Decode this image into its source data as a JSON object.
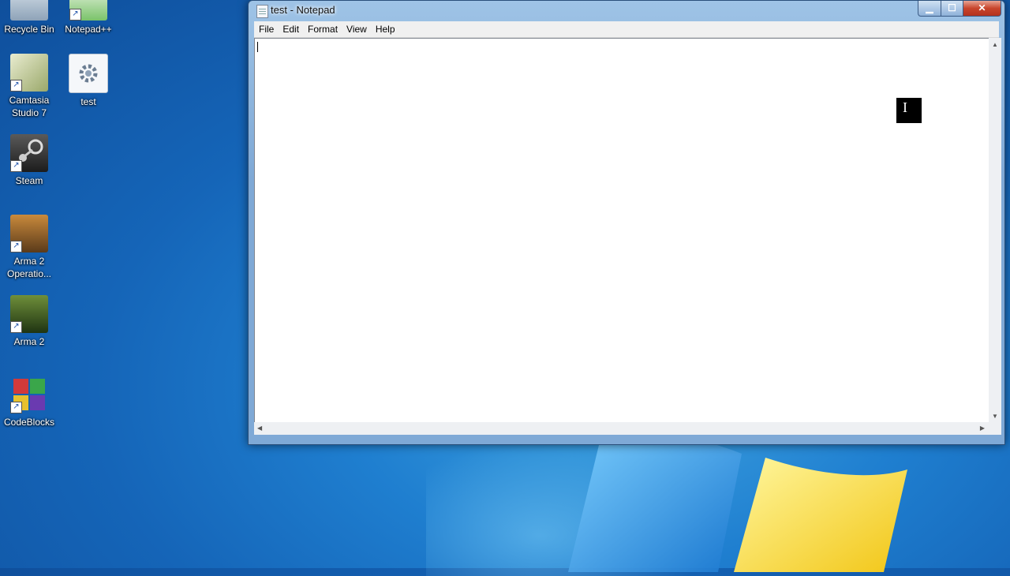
{
  "desktop": {
    "icons": [
      {
        "label": "Recycle Bin",
        "icon": "recycle-bin-icon",
        "color": "#9fb3c8"
      },
      {
        "label": "Notepad++",
        "icon": "notepad-plus-plus-icon",
        "color": "#5cb85c"
      },
      {
        "label": "Camtasia Studio 7",
        "icon": "camtasia-icon",
        "color": "#c9d3a0"
      },
      {
        "label": "test",
        "icon": "config-file-icon",
        "color": "#e8eef5"
      },
      {
        "label": "Steam",
        "icon": "steam-icon",
        "color": "#2b2b2b"
      },
      {
        "label": "Arma 2 Operatio...",
        "icon": "arma2-oa-icon",
        "color": "#8a5a2b"
      },
      {
        "label": "Arma 2",
        "icon": "arma2-icon",
        "color": "#3f5f2a"
      },
      {
        "label": "CodeBlocks",
        "icon": "codeblocks-icon",
        "color": "#c0392b"
      }
    ]
  },
  "window": {
    "title": "test - Notepad",
    "buttons": {
      "minimize": "▁",
      "maximize": "☐",
      "close": "✕"
    },
    "menu": [
      "File",
      "Edit",
      "Format",
      "View",
      "Help"
    ],
    "content": ""
  },
  "cursor": "I"
}
